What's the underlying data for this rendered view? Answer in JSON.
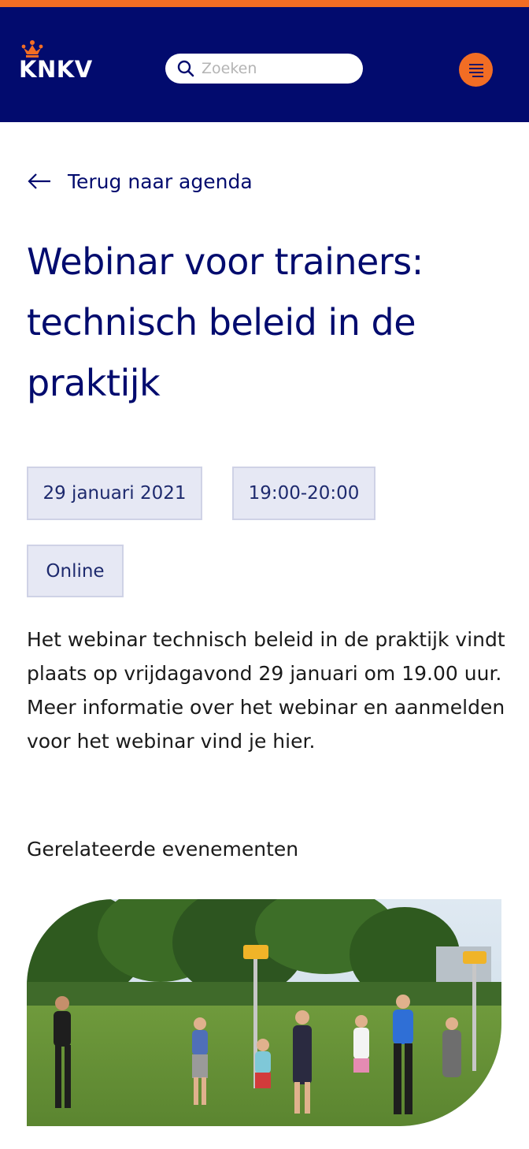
{
  "header": {
    "logo_text": "KNKV",
    "search": {
      "placeholder": "Zoeken",
      "value": ""
    }
  },
  "icons": {
    "search": "search-icon",
    "menu": "hamburger-menu-icon",
    "back": "arrow-left-icon",
    "crown": "crown-icon"
  },
  "colors": {
    "brand_navy": "#020b6e",
    "brand_orange": "#f26d24",
    "tag_bg": "#e6e8f4"
  },
  "nav": {
    "back_label": "Terug naar agenda"
  },
  "event": {
    "title": "Webinar voor trainers: technisch beleid in de praktijk",
    "date": "29 januari 2021",
    "time": "19:00-20:00",
    "location": "Online",
    "description": "Het webinar technisch beleid in de praktijk vindt plaats op vrijdagavond 29 januari om 19.00 uur. Meer informatie over het webinar en aanmelden voor het webinar vind je hier."
  },
  "related": {
    "heading": "Gerelateerde evenementen"
  }
}
